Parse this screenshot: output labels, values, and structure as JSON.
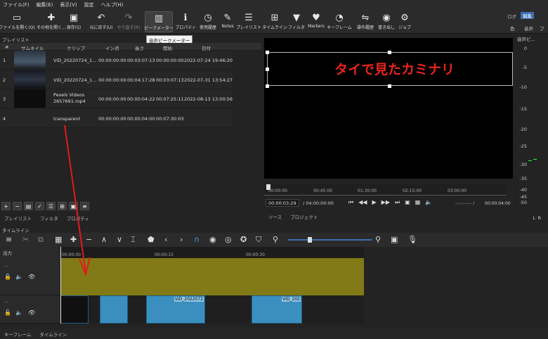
{
  "menu": [
    "ファイル(F)",
    "編集(E)",
    "表示(V)",
    "設定",
    "ヘルプ(H)"
  ],
  "toolbar": [
    {
      "icon": "open-file-icon",
      "label": "ファイルを開く(O)"
    },
    {
      "icon": "open-other-icon",
      "label": "その他を開く..."
    },
    {
      "icon": "save-icon",
      "label": "保存(S)"
    },
    {
      "icon": "undo-icon",
      "label": "元に戻す(U)"
    },
    {
      "icon": "redo-icon",
      "label": "やり直す(R)"
    },
    {
      "icon": "peak-meter-icon",
      "label": "ピークメーター"
    },
    {
      "icon": "properties-icon",
      "label": "プロパティ"
    },
    {
      "icon": "history-icon",
      "label": "使用履歴"
    },
    {
      "icon": "notes-icon",
      "label": "Notes"
    },
    {
      "icon": "playlist-icon",
      "label": "プレイリスト"
    },
    {
      "icon": "timeline-icon",
      "label": "タイムライン"
    },
    {
      "icon": "filter-icon",
      "label": "フィルタ"
    },
    {
      "icon": "markers-icon",
      "label": "Markers"
    },
    {
      "icon": "keyframes-icon",
      "label": "キーフレーム"
    },
    {
      "icon": "job-history-icon",
      "label": "操作履歴"
    },
    {
      "icon": "export-icon",
      "label": "書き出し"
    },
    {
      "icon": "jobs-icon",
      "label": "ジョブ"
    }
  ],
  "layout_tabs": [
    "ログ",
    "編集",
    "色",
    "音声",
    "プレー"
  ],
  "tooltip": "音声ピークメーター",
  "playlist": {
    "title": "プレイリスト",
    "columns": [
      "#",
      "サムネイル",
      "クリップ",
      "イン点",
      "長さ",
      "開始",
      "日付"
    ],
    "rows": [
      {
        "num": "1",
        "clip": "VID_20220724_1...",
        "in": "00:00:00:00",
        "dur": "00:03:07:13",
        "start": "00:00:00:00",
        "date": "2022-07-24 19:46:20"
      },
      {
        "num": "2",
        "clip": "VID_20220724_1...",
        "in": "00:00:00:00",
        "dur": "00:04:17:28",
        "start": "00:03:07:13",
        "date": "2022-07-31 13:54:27"
      },
      {
        "num": "3",
        "clip": "Pexels Videos 2657691.mp4",
        "in": "00:00:00:00",
        "dur": "00:00:04:22",
        "start": "00:07:25:11",
        "date": "2022-08-13 13:00:56"
      },
      {
        "num": "4",
        "clip": "transparent",
        "in": "00:00:00:00",
        "dur": "00:00:04:00",
        "start": "00:07:30:03",
        "date": ""
      }
    ],
    "tabs": [
      "プレイリスト",
      "フィルタ",
      "プロパティ"
    ]
  },
  "viewer": {
    "overlay_text": "タイで見たカミナリ",
    "overlay_color": "#e8241b",
    "ruler_ticks": [
      "00:00:00",
      "00:45:00",
      "01:30:00",
      "02:15:00",
      "03:00:00"
    ],
    "current_time": "00:00:03:29",
    "total_time": "/ 04:00:00:00",
    "in_out": "--:--:--:-- /",
    "right_time": "00:00:04:00",
    "tabs": [
      "ソース",
      "プロジェクト"
    ]
  },
  "audio_meter": {
    "title": "音声ピ...",
    "scale": [
      "0",
      "-5",
      "-10",
      "-15",
      "-20",
      "-25",
      "-30",
      "-35",
      "-40",
      "-45",
      "-50"
    ],
    "channels": [
      "L",
      "R"
    ]
  },
  "timeline": {
    "title": "タイムライン",
    "output_label": "出力",
    "ruler_ticks": [
      "00:00:00",
      "00:00:15",
      "00:00:30"
    ],
    "track1_label": "...",
    "track2_label": "...",
    "clips": [
      {
        "name": "VID_2022072",
        "start": 208,
        "width": 84
      },
      {
        "name": "VID_202",
        "start": 358,
        "width": 72
      }
    ]
  },
  "status_tabs": [
    "キーフレーム",
    "タイムライン"
  ]
}
